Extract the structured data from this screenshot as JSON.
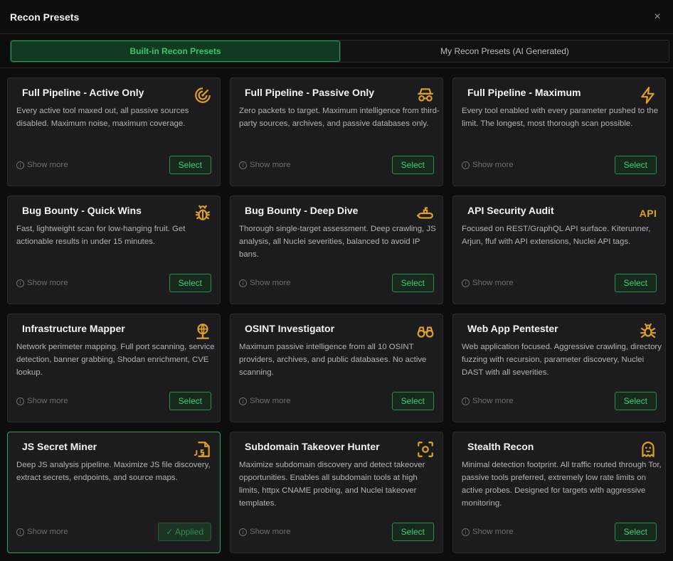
{
  "modal": {
    "title": "Recon Presets",
    "close": "×"
  },
  "tabs": [
    {
      "label": "Built-in Recon Presets",
      "active": true
    },
    {
      "label": "My Recon Presets (AI Generated)",
      "active": false
    }
  ],
  "colors": {
    "accent": "#36c96b",
    "icon": "#e0a020",
    "card_bg": "#1c1c1e"
  },
  "show_more_label": "Show more",
  "select_label": "Select",
  "applied_label": "✓ Applied",
  "presets": [
    {
      "title": "Full Pipeline - Active Only",
      "icon": "target-radar-icon",
      "desc": "Every active tool maxed out, all passive sources disabled. Maximum noise, maximum coverage.",
      "applied": false
    },
    {
      "title": "Full Pipeline - Passive Only",
      "icon": "incognito-icon",
      "desc": "Zero packets to target. Maximum intelligence from third-party sources, archives, and passive databases only.",
      "applied": false
    },
    {
      "title": "Full Pipeline - Maximum",
      "icon": "lightning-icon",
      "desc": "Every tool enabled with every parameter pushed to the limit. The longest, most thorough scan possible.",
      "applied": false
    },
    {
      "title": "Bug Bounty - Quick Wins",
      "icon": "bug-icon",
      "desc": "Fast, lightweight scan for low-hanging fruit. Get actionable results in under 15 minutes.",
      "applied": false
    },
    {
      "title": "Bug Bounty - Deep Dive",
      "icon": "submarine-icon",
      "desc": "Thorough single-target assessment. Deep crawling, JS analysis, all Nuclei severities, balanced to avoid IP bans.",
      "applied": false
    },
    {
      "title": "API Security Audit",
      "icon": "api-icon",
      "icon_text": "API",
      "desc": "Focused on REST/GraphQL API surface. Kiterunner, Arjun, ffuf with API extensions, Nuclei API tags.",
      "applied": false
    },
    {
      "title": "Infrastructure Mapper",
      "icon": "network-globe-icon",
      "desc": "Network perimeter mapping. Full port scanning, service detection, banner grabbing, Shodan enrichment, CVE lookup.",
      "applied": false
    },
    {
      "title": "OSINT Investigator",
      "icon": "binoculars-icon",
      "desc": "Maximum passive intelligence from all 10 OSINT providers, archives, and public databases. No active scanning.",
      "applied": false
    },
    {
      "title": "Web App Pentester",
      "icon": "spider-icon",
      "desc": "Web application focused. Aggressive crawling, directory fuzzing with recursion, parameter discovery, Nuclei DAST with all severities.",
      "applied": false
    },
    {
      "title": "JS Secret Miner",
      "icon": "js-file-icon",
      "desc": "Deep JS analysis pipeline. Maximize JS file discovery, extract secrets, endpoints, and source maps.",
      "applied": true
    },
    {
      "title": "Subdomain Takeover Hunter",
      "icon": "scan-focus-icon",
      "desc": "Maximize subdomain discovery and detect takeover opportunities. Enables all subdomain tools at high limits, httpx CNAME probing, and Nuclei takeover templates.",
      "applied": false
    },
    {
      "title": "Stealth Recon",
      "icon": "ghost-icon",
      "desc": "Minimal detection footprint. All traffic routed through Tor, passive tools preferred, extremely low rate limits on active probes. Designed for targets with aggressive monitoring.",
      "applied": false
    }
  ]
}
